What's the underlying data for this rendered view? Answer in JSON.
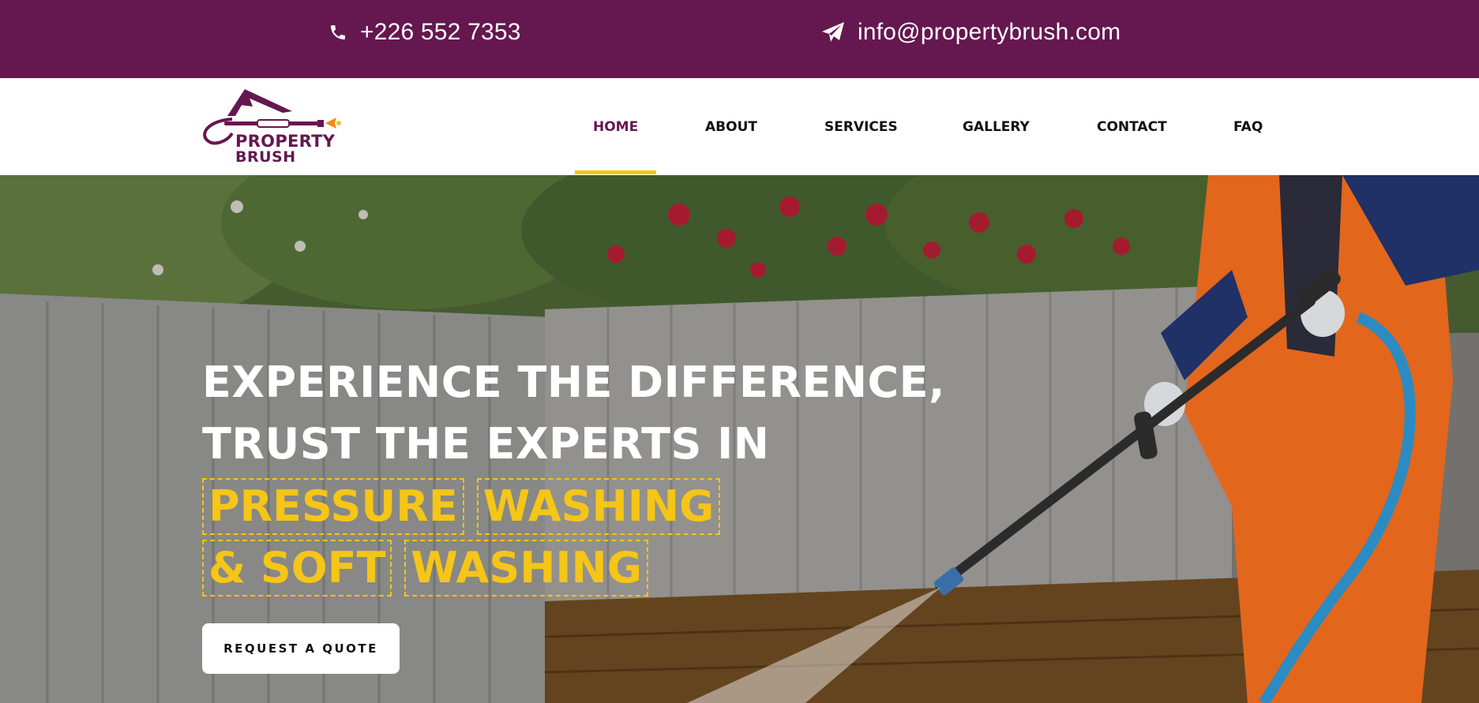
{
  "topbar": {
    "phone": "+226 552 7353",
    "email": "info@propertybrush.com",
    "phone_icon": "phone-icon",
    "email_icon": "paper-plane-icon",
    "background": "#65174f"
  },
  "logo": {
    "line1": "PROPERTY",
    "line2": "BRUSH",
    "color": "#65174f"
  },
  "nav": {
    "items": [
      {
        "label": "HOME",
        "active": true
      },
      {
        "label": "ABOUT"
      },
      {
        "label": "SERVICES"
      },
      {
        "label": "GALLERY"
      },
      {
        "label": "CONTACT"
      },
      {
        "label": "FAQ"
      }
    ],
    "accent": "#f5c518"
  },
  "hero": {
    "line1": "EXPERIENCE THE DIFFERENCE,",
    "line2": "TRUST THE EXPERTS IN",
    "highlights_row1": [
      "PRESSURE",
      "WASHING"
    ],
    "highlights_row2": [
      "& SOFT",
      "WASHING"
    ],
    "highlight_color": "#f5c518",
    "cta": "REQUEST A QUOTE"
  }
}
